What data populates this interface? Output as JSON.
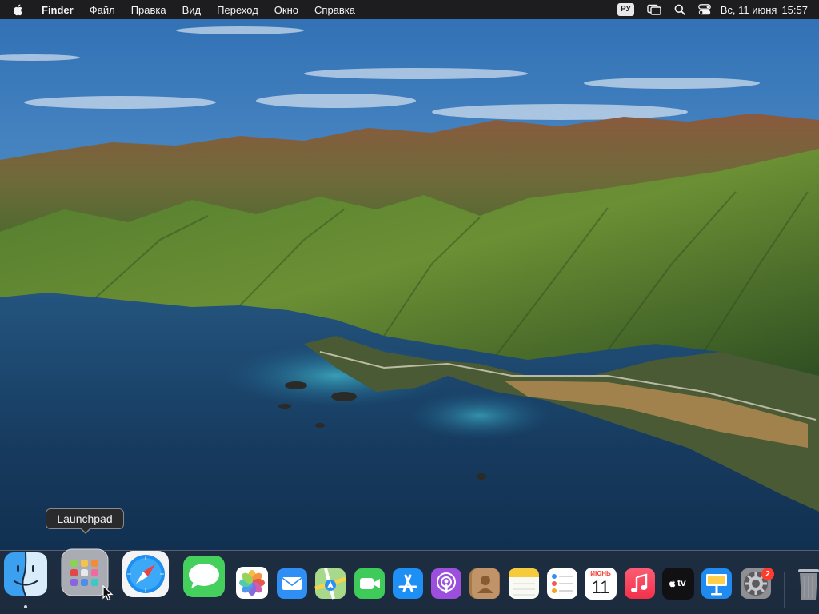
{
  "menubar": {
    "apple_icon": "apple-logo-icon",
    "app_name": "Finder",
    "menus": [
      "Файл",
      "Правка",
      "Вид",
      "Переход",
      "Окно",
      "Справка"
    ],
    "input_source": "РУ",
    "status_icons": [
      "screen-mirroring-icon",
      "spotlight-search-icon",
      "control-center-icon"
    ],
    "date": "Вс, 11 июня",
    "time": "15:57"
  },
  "tooltip": {
    "label": "Launchpad"
  },
  "dock": {
    "apps": [
      {
        "name": "Finder",
        "icon": "finder-icon",
        "running": true
      },
      {
        "name": "Launchpad",
        "icon": "launchpad-icon",
        "running": false,
        "hovered": true
      },
      {
        "name": "Safari",
        "icon": "safari-icon",
        "running": false
      },
      {
        "name": "Messages",
        "icon": "messages-icon",
        "running": false
      },
      {
        "name": "Photos",
        "icon": "photos-icon",
        "running": false
      },
      {
        "name": "Mail",
        "icon": "mail-icon",
        "running": false
      },
      {
        "name": "Maps",
        "icon": "maps-icon",
        "running": false
      },
      {
        "name": "FaceTime",
        "icon": "facetime-icon",
        "running": false
      },
      {
        "name": "App Store",
        "icon": "app-store-icon",
        "running": false
      },
      {
        "name": "Podcasts",
        "icon": "podcasts-icon",
        "running": false
      },
      {
        "name": "Contacts",
        "icon": "contacts-icon",
        "running": false
      },
      {
        "name": "Notes",
        "icon": "notes-icon",
        "running": false
      },
      {
        "name": "Reminders",
        "icon": "reminders-icon",
        "running": false
      },
      {
        "name": "Calendar",
        "icon": "calendar-icon",
        "running": false
      },
      {
        "name": "Music",
        "icon": "music-icon",
        "running": false
      },
      {
        "name": "TV",
        "icon": "apple-tv-icon",
        "running": false
      },
      {
        "name": "Keynote",
        "icon": "keynote-icon",
        "running": false
      },
      {
        "name": "System Preferences",
        "icon": "system-preferences-icon",
        "running": false
      },
      {
        "name": "Trash",
        "icon": "trash-icon",
        "running": false
      }
    ],
    "calendar_month": "ИЮНЬ",
    "calendar_day": "11",
    "tv_label": "tv",
    "system_preferences_badge": "2"
  },
  "colors": {
    "menubar_bg": "#1d1d1f",
    "sky": "#4a86c5",
    "sea": "#1e4a78",
    "mountains": "#5a7a3a",
    "badge_red": "#ff3b30"
  }
}
